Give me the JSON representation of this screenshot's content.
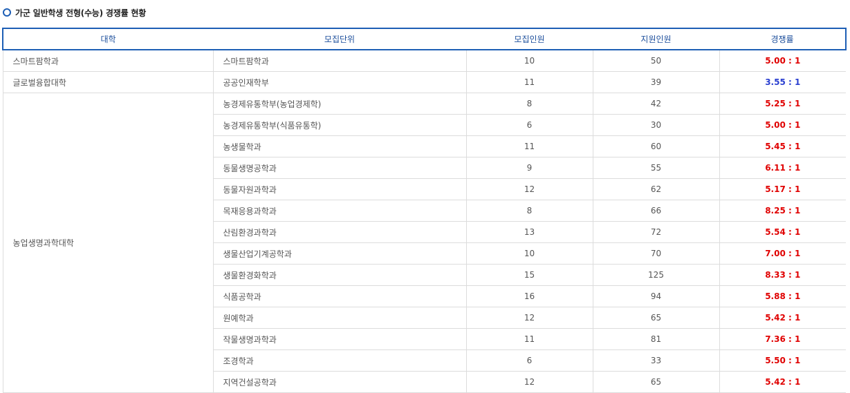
{
  "title": "가군 일반학생 전형(수능) 경쟁률 현황",
  "colors": {
    "accent": "#1d5eb5",
    "high_rate": "#e00000",
    "low_rate": "#2a3fd0"
  },
  "columns": [
    "대학",
    "모집단위",
    "모집인원",
    "지원인원",
    "경쟁률"
  ],
  "groups": [
    {
      "college": "스마트팜학과",
      "rows": [
        {
          "unit": "스마트팜학과",
          "quota": "10",
          "applicants": "50",
          "rate": "5.00 : 1",
          "rate_color": "red"
        }
      ]
    },
    {
      "college": "글로벌융합대학",
      "rows": [
        {
          "unit": "공공인재학부",
          "quota": "11",
          "applicants": "39",
          "rate": "3.55 : 1",
          "rate_color": "blue"
        }
      ]
    },
    {
      "college": "농업생명과학대학",
      "rows": [
        {
          "unit": "농경제유통학부(농업경제학)",
          "quota": "8",
          "applicants": "42",
          "rate": "5.25 : 1",
          "rate_color": "red"
        },
        {
          "unit": "농경제유통학부(식품유통학)",
          "quota": "6",
          "applicants": "30",
          "rate": "5.00 : 1",
          "rate_color": "red"
        },
        {
          "unit": "농생물학과",
          "quota": "11",
          "applicants": "60",
          "rate": "5.45 : 1",
          "rate_color": "red"
        },
        {
          "unit": "동물생명공학과",
          "quota": "9",
          "applicants": "55",
          "rate": "6.11 : 1",
          "rate_color": "red"
        },
        {
          "unit": "동물자원과학과",
          "quota": "12",
          "applicants": "62",
          "rate": "5.17 : 1",
          "rate_color": "red"
        },
        {
          "unit": "목재응용과학과",
          "quota": "8",
          "applicants": "66",
          "rate": "8.25 : 1",
          "rate_color": "red"
        },
        {
          "unit": "산림환경과학과",
          "quota": "13",
          "applicants": "72",
          "rate": "5.54 : 1",
          "rate_color": "red"
        },
        {
          "unit": "생물산업기계공학과",
          "quota": "10",
          "applicants": "70",
          "rate": "7.00 : 1",
          "rate_color": "red"
        },
        {
          "unit": "생물환경화학과",
          "quota": "15",
          "applicants": "125",
          "rate": "8.33 : 1",
          "rate_color": "red"
        },
        {
          "unit": "식품공학과",
          "quota": "16",
          "applicants": "94",
          "rate": "5.88 : 1",
          "rate_color": "red"
        },
        {
          "unit": "원예학과",
          "quota": "12",
          "applicants": "65",
          "rate": "5.42 : 1",
          "rate_color": "red"
        },
        {
          "unit": "작물생명과학과",
          "quota": "11",
          "applicants": "81",
          "rate": "7.36 : 1",
          "rate_color": "red"
        },
        {
          "unit": "조경학과",
          "quota": "6",
          "applicants": "33",
          "rate": "5.50 : 1",
          "rate_color": "red"
        },
        {
          "unit": "지역건설공학과",
          "quota": "12",
          "applicants": "65",
          "rate": "5.42 : 1",
          "rate_color": "red"
        }
      ]
    }
  ]
}
